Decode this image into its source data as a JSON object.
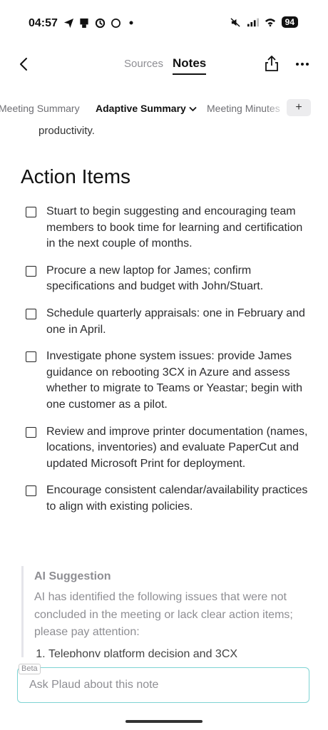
{
  "status_bar": {
    "time": "04:57",
    "battery": "94",
    "left_icons": [
      "send-icon",
      "notification-icon",
      "sync-icon",
      "circle-icon",
      "dot-icon"
    ],
    "right_icons": [
      "mute-icon",
      "signal-icon",
      "wifi-icon"
    ]
  },
  "nav": {
    "tabs": [
      {
        "label": "Sources",
        "active": false
      },
      {
        "label": "Notes",
        "active": true
      }
    ]
  },
  "template_tabs": {
    "items": [
      {
        "label": "Meeting Summary"
      },
      {
        "label": "Adaptive Summary",
        "active": true
      },
      {
        "label": "Meeting Minutes"
      }
    ],
    "add_label": "+"
  },
  "content": {
    "clipped_text": "productivity.",
    "section_title": "Action Items",
    "action_items": [
      "Stuart to begin suggesting and encouraging team members to book time for learning and certification in the next couple of months.",
      "Procure a new laptop for James; confirm specifications and budget with John/Stuart.",
      "Schedule quarterly appraisals: one in February and one in April.",
      "Investigate phone system issues: provide James guidance on rebooting 3CX in Azure and assess whether to migrate to Teams or Yeastar; begin with one customer as a pilot.",
      "Review and improve printer documentation (names, locations, inventories) and evaluate PaperCut and updated Microsoft Print for deployment.",
      "Encourage consistent calendar/availability practices to align with existing policies."
    ],
    "ai_suggestion": {
      "title": "AI Suggestion",
      "body": "AI has identified the following issues that were not concluded in the meeting or lack clear action items; please pay attention:",
      "items": [
        "Telephony platform decision and 3CX"
      ]
    }
  },
  "ask": {
    "beta_label": "Beta",
    "placeholder": "Ask Plaud about this note"
  },
  "colors": {
    "accent_border": "#7ed3d3",
    "muted_text": "#8e8e93"
  }
}
